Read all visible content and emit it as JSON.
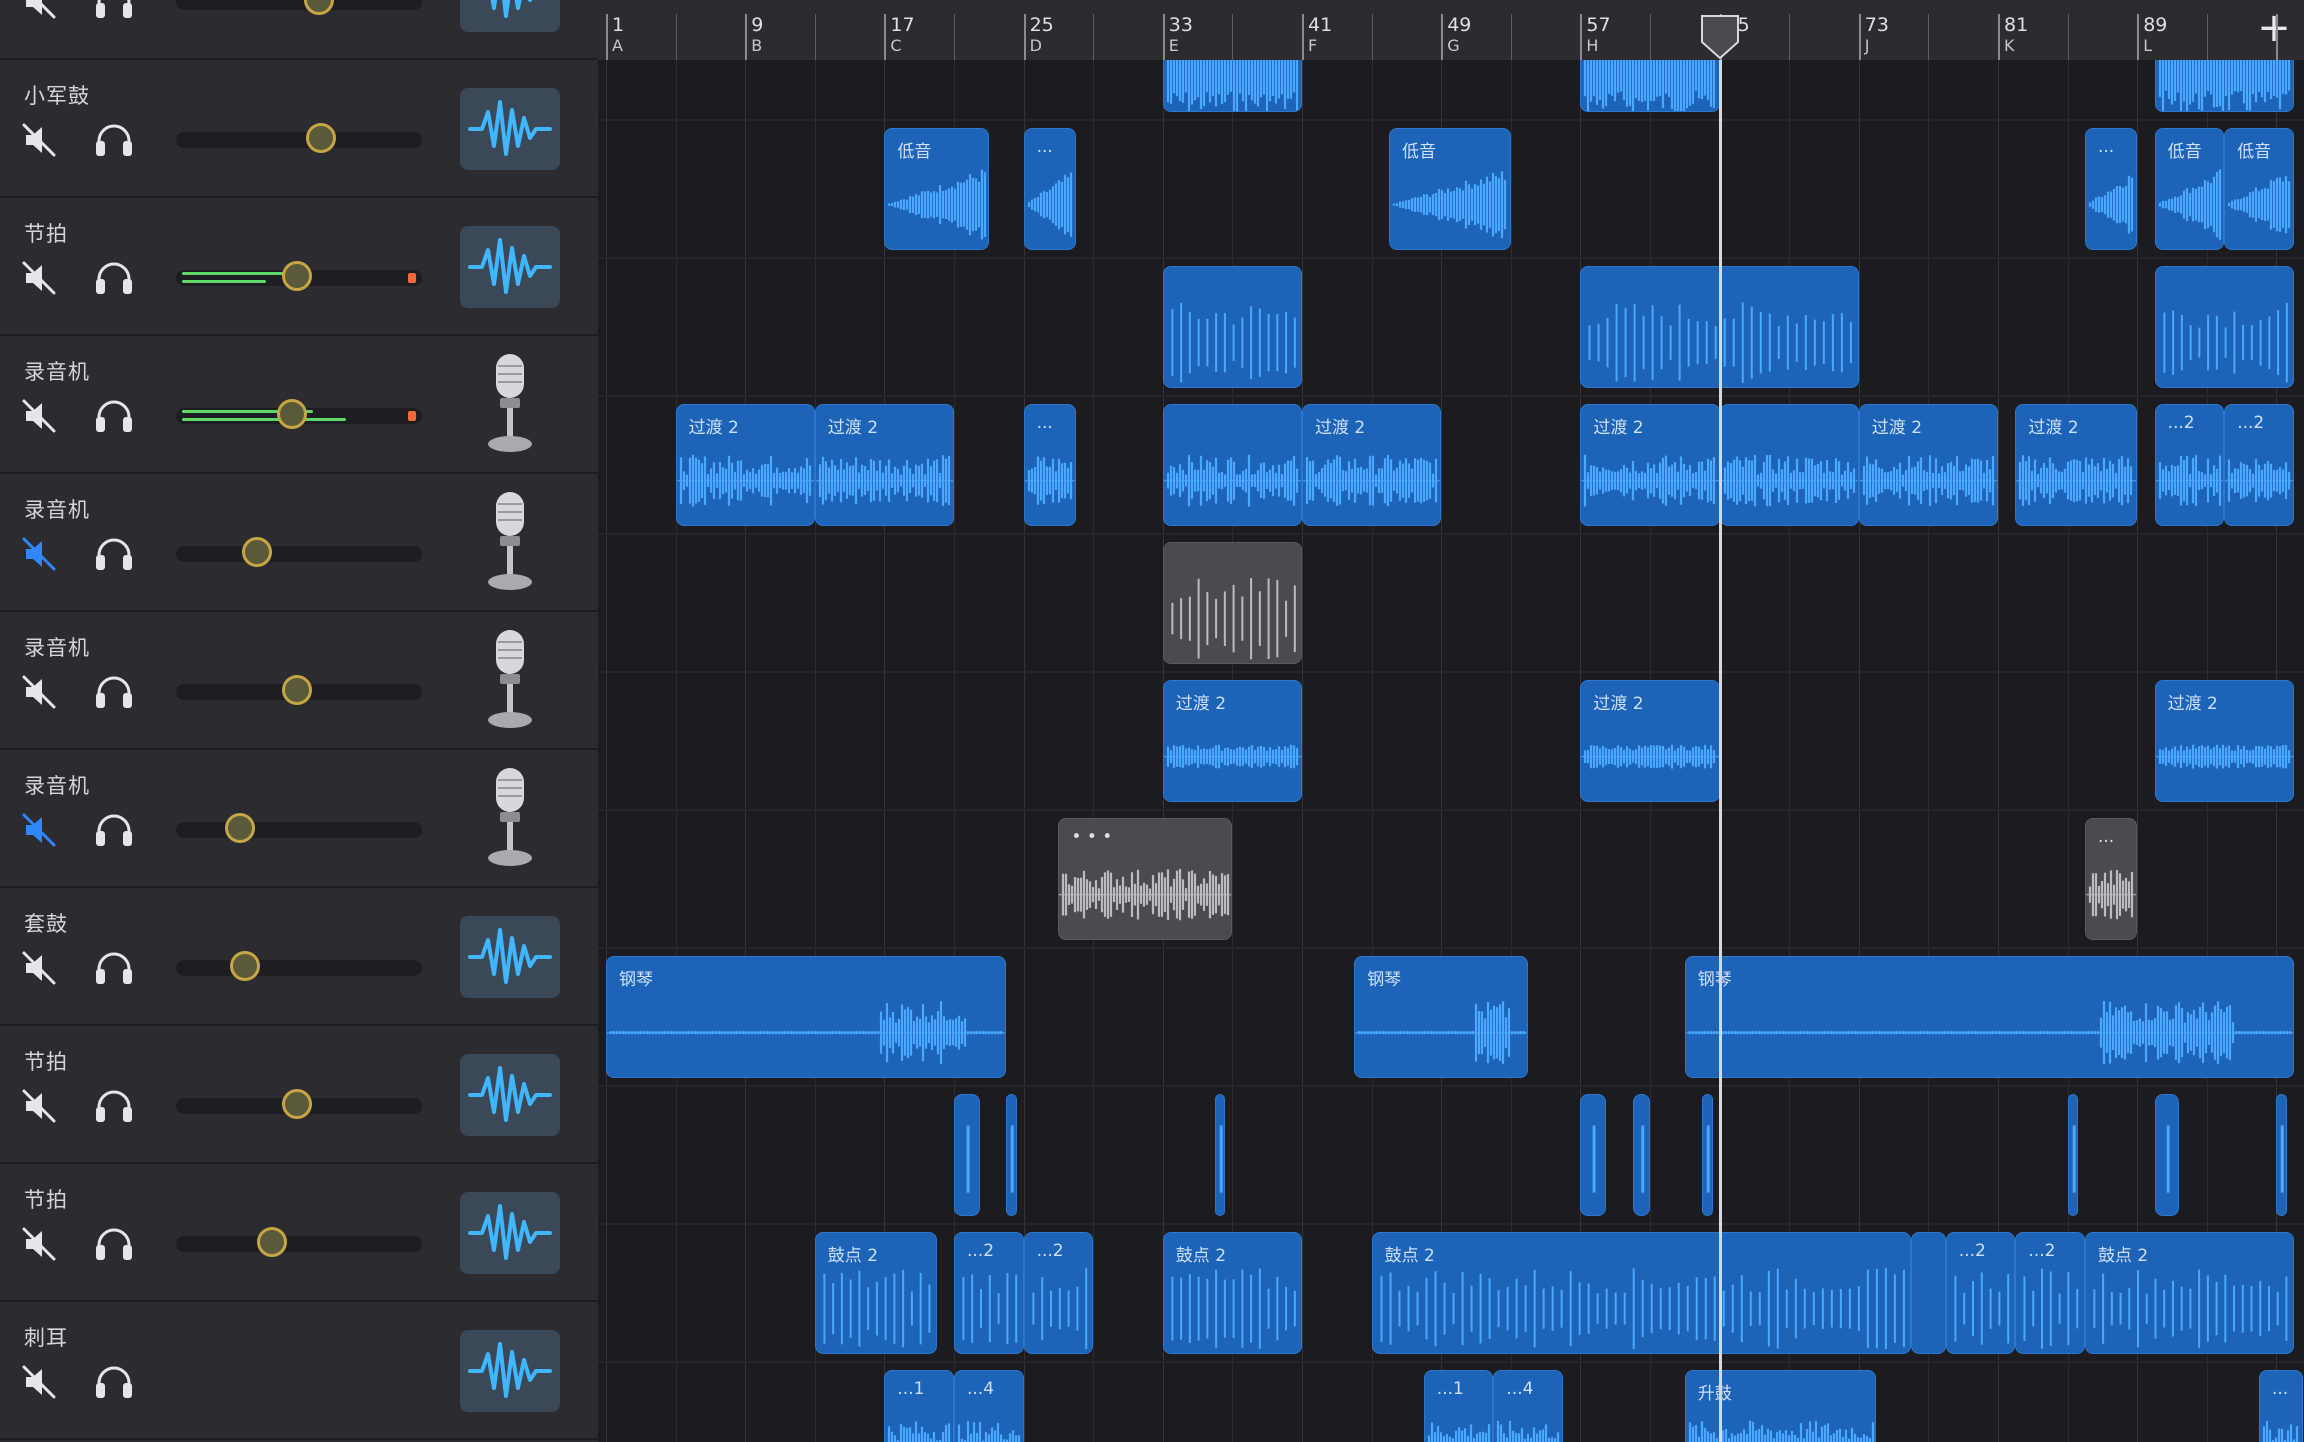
{
  "tracks": [
    {
      "name": "",
      "icon": "waveform-icon",
      "volume": 0.58,
      "muted": false,
      "meter": null
    },
    {
      "name": "小军鼓",
      "icon": "waveform-icon",
      "volume": 0.59,
      "muted": false,
      "meter": null
    },
    {
      "name": "节拍",
      "icon": "waveform-icon",
      "volume": 0.49,
      "muted": false,
      "meter": [
        0.44,
        0.36
      ]
    },
    {
      "name": "录音机",
      "icon": "microphone-icon",
      "volume": 0.47,
      "muted": false,
      "meter": [
        0.56,
        0.7
      ]
    },
    {
      "name": "录音机",
      "icon": "microphone-icon",
      "volume": 0.33,
      "muted": true,
      "meter": null
    },
    {
      "name": "录音机",
      "icon": "microphone-icon",
      "volume": 0.49,
      "muted": false,
      "meter": null
    },
    {
      "name": "录音机",
      "icon": "microphone-icon",
      "volume": 0.26,
      "muted": true,
      "meter": null
    },
    {
      "name": "套鼓",
      "icon": "waveform-icon",
      "volume": 0.28,
      "muted": false,
      "meter": null
    },
    {
      "name": "节拍",
      "icon": "waveform-icon",
      "volume": 0.49,
      "muted": false,
      "meter": null
    },
    {
      "name": "节拍",
      "icon": "waveform-icon",
      "volume": 0.39,
      "muted": false,
      "meter": null
    },
    {
      "name": "刺耳",
      "icon": "waveform-icon",
      "volume": null,
      "muted": false,
      "meter": null
    }
  ],
  "ruler": {
    "bars": [
      "1",
      "9",
      "17",
      "25",
      "33",
      "41",
      "49",
      "57",
      "65",
      "73",
      "81",
      "89"
    ],
    "markers": [
      "A",
      "B",
      "C",
      "D",
      "E",
      "F",
      "G",
      "H",
      "",
      "J",
      "K",
      "L"
    ],
    "playhead_bar": "65",
    "add_label": "+"
  },
  "regions": [
    {
      "track": 0,
      "start": 33,
      "end": 41,
      "label": "",
      "wave": "dense"
    },
    {
      "track": 0,
      "start": 57,
      "end": 65,
      "label": "",
      "wave": "dense"
    },
    {
      "track": 0,
      "start": 90,
      "end": 98,
      "label": "",
      "wave": "dense"
    },
    {
      "track": 1,
      "start": 17,
      "end": 23,
      "label": "低音",
      "wave": "swell"
    },
    {
      "track": 1,
      "start": 25,
      "end": 28,
      "label": "...",
      "wave": "swell"
    },
    {
      "track": 1,
      "start": 46,
      "end": 53,
      "label": "低音",
      "wave": "swell"
    },
    {
      "track": 1,
      "start": 86,
      "end": 89,
      "label": "...",
      "wave": "swell"
    },
    {
      "track": 1,
      "start": 90,
      "end": 94,
      "label": "低音",
      "wave": "swell"
    },
    {
      "track": 1,
      "start": 94,
      "end": 98,
      "label": "低音",
      "wave": "swell"
    },
    {
      "track": 2,
      "start": 33,
      "end": 41,
      "label": "",
      "wave": "spikes"
    },
    {
      "track": 2,
      "start": 57,
      "end": 73,
      "label": "",
      "wave": "spikes"
    },
    {
      "track": 2,
      "start": 90,
      "end": 98,
      "label": "",
      "wave": "spikes"
    },
    {
      "track": 3,
      "start": 5,
      "end": 13,
      "label": "过渡 2",
      "wave": "noise"
    },
    {
      "track": 3,
      "start": 13,
      "end": 21,
      "label": "过渡 2",
      "wave": "noise"
    },
    {
      "track": 3,
      "start": 25,
      "end": 28,
      "label": "...",
      "wave": "noise"
    },
    {
      "track": 3,
      "start": 33,
      "end": 41,
      "label": "",
      "wave": "noise"
    },
    {
      "track": 3,
      "start": 41,
      "end": 49,
      "label": "过渡 2",
      "wave": "noise"
    },
    {
      "track": 3,
      "start": 57,
      "end": 65,
      "label": "过渡 2",
      "wave": "noise"
    },
    {
      "track": 3,
      "start": 65,
      "end": 73,
      "label": "",
      "wave": "noise"
    },
    {
      "track": 3,
      "start": 73,
      "end": 81,
      "label": "过渡 2",
      "wave": "noise"
    },
    {
      "track": 3,
      "start": 82,
      "end": 89,
      "label": "过渡 2",
      "wave": "noise"
    },
    {
      "track": 3,
      "start": 90,
      "end": 94,
      "label": "...2",
      "wave": "noise"
    },
    {
      "track": 3,
      "start": 94,
      "end": 98,
      "label": "...2",
      "wave": "noise"
    },
    {
      "track": 4,
      "start": 33,
      "end": 41,
      "label": "",
      "wave": "spikes",
      "muted": true
    },
    {
      "track": 5,
      "start": 33,
      "end": 41,
      "label": "过渡 2",
      "wave": "band"
    },
    {
      "track": 5,
      "start": 57,
      "end": 65,
      "label": "过渡 2",
      "wave": "band"
    },
    {
      "track": 5,
      "start": 90,
      "end": 98,
      "label": "过渡 2",
      "wave": "band"
    },
    {
      "track": 6,
      "start": 27,
      "end": 37,
      "label": "• • •",
      "wave": "noise",
      "muted": true
    },
    {
      "track": 6,
      "start": 86,
      "end": 89,
      "label": "...",
      "wave": "noise",
      "muted": true
    },
    {
      "track": 7,
      "start": 1,
      "end": 24,
      "label": "钢琴",
      "wave": "piano"
    },
    {
      "track": 7,
      "start": 44,
      "end": 54,
      "label": "钢琴",
      "wave": "piano"
    },
    {
      "track": 7,
      "start": 63,
      "end": 98,
      "label": "钢琴",
      "wave": "piano"
    },
    {
      "track": 8,
      "start": 21,
      "end": 22.5,
      "label": "",
      "wave": "tick"
    },
    {
      "track": 8,
      "start": 24,
      "end": 24.6,
      "label": "",
      "wave": "tick"
    },
    {
      "track": 8,
      "start": 36,
      "end": 36.6,
      "label": "",
      "wave": "tick"
    },
    {
      "track": 8,
      "start": 57,
      "end": 58.5,
      "label": "",
      "wave": "tick"
    },
    {
      "track": 8,
      "start": 60,
      "end": 61,
      "label": "",
      "wave": "tick"
    },
    {
      "track": 8,
      "start": 64,
      "end": 64.6,
      "label": "",
      "wave": "tick"
    },
    {
      "track": 8,
      "start": 85,
      "end": 85.6,
      "label": "",
      "wave": "tick"
    },
    {
      "track": 8,
      "start": 90,
      "end": 91.4,
      "label": "",
      "wave": "tick"
    },
    {
      "track": 8,
      "start": 97,
      "end": 97.6,
      "label": "",
      "wave": "tick"
    },
    {
      "track": 9,
      "start": 13,
      "end": 20,
      "label": "鼓点 2",
      "wave": "spikes"
    },
    {
      "track": 9,
      "start": 21,
      "end": 25,
      "label": "...2",
      "wave": "spikes"
    },
    {
      "track": 9,
      "start": 25,
      "end": 29,
      "label": "...2",
      "wave": "spikes"
    },
    {
      "track": 9,
      "start": 33,
      "end": 41,
      "label": "鼓点 2",
      "wave": "spikes"
    },
    {
      "track": 9,
      "start": 45,
      "end": 76,
      "label": "鼓点 2",
      "wave": "spikes"
    },
    {
      "track": 9,
      "start": 76,
      "end": 78,
      "label": "",
      "wave": "none"
    },
    {
      "track": 9,
      "start": 78,
      "end": 82,
      "label": "...2",
      "wave": "spikes"
    },
    {
      "track": 9,
      "start": 82,
      "end": 86,
      "label": "...2",
      "wave": "spikes"
    },
    {
      "track": 9,
      "start": 86,
      "end": 98,
      "label": "鼓点 2",
      "wave": "spikes"
    },
    {
      "track": 10,
      "start": 17,
      "end": 21,
      "label": "...1",
      "wave": "noise"
    },
    {
      "track": 10,
      "start": 21,
      "end": 25,
      "label": "...4",
      "wave": "noise"
    },
    {
      "track": 10,
      "start": 48,
      "end": 52,
      "label": "...1",
      "wave": "noise"
    },
    {
      "track": 10,
      "start": 52,
      "end": 56,
      "label": "...4",
      "wave": "noise"
    },
    {
      "track": 10,
      "start": 63,
      "end": 74,
      "label": "升鼓",
      "wave": "noise"
    },
    {
      "track": 10,
      "start": 96,
      "end": 98.5,
      "label": "...",
      "wave": "noise"
    }
  ],
  "colors": {
    "region": "#1d63b8",
    "wave": "#4aa8ff",
    "muted_region": "#4a4a4f",
    "muted_icon": "#2f86ff",
    "playhead": "#d7d7dc"
  }
}
